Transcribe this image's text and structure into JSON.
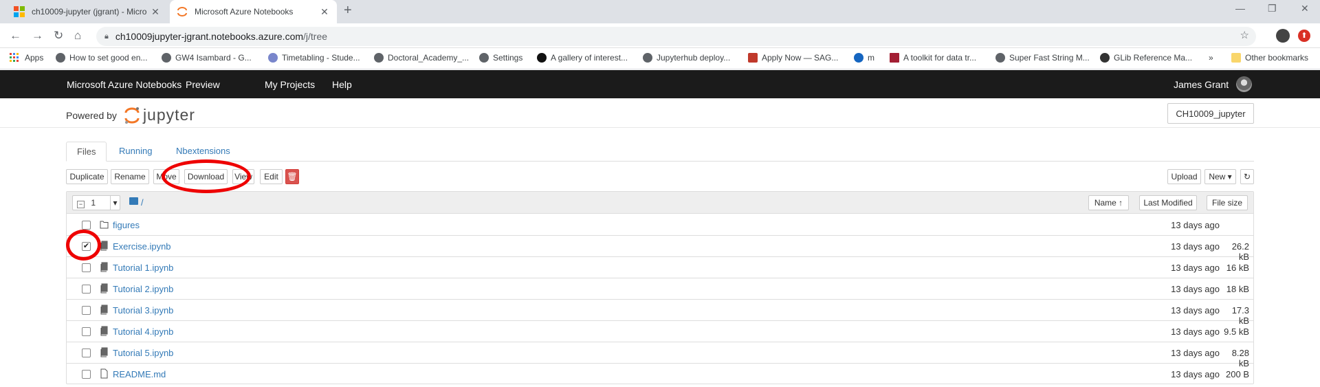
{
  "browser": {
    "tabs": [
      {
        "title": "ch10009-jupyter (jgrant) - Micro"
      },
      {
        "title": "Microsoft Azure Notebooks"
      }
    ],
    "url_host": "ch10009jupyter-jgrant.notebooks.azure.com",
    "url_path": "/j/tree",
    "bookmarks": [
      "Apps",
      "How to set good en...",
      "GW4 Isambard - G...",
      "Timetabling - Stude...",
      "Doctoral_Academy_...",
      "Settings",
      "A gallery of interest...",
      "Jupyterhub deploy...",
      "Apply Now — SAG...",
      "m",
      "A toolkit for data tr...",
      "Super Fast String M...",
      "GLib Reference Ma..."
    ],
    "other_bookmarks": "Other bookmarks",
    "overflow": "»"
  },
  "azure_nav": {
    "brand": "Microsoft Azure Notebooks",
    "preview": "Preview",
    "my_projects": "My Projects",
    "help": "Help",
    "user": "James Grant"
  },
  "header": {
    "powered_by": "Powered by",
    "logo_text": "jupyter",
    "project_button": "CH10009_jupyter"
  },
  "tabs": [
    "Files",
    "Running",
    "Nbextensions"
  ],
  "actions": {
    "duplicate": "Duplicate",
    "rename": "Rename",
    "move": "Move",
    "download": "Download",
    "view": "View",
    "edit": "Edit",
    "upload": "Upload",
    "new": "New ▾"
  },
  "list_header": {
    "selected_count": "1",
    "path": "/",
    "name_col": "Name ↑",
    "modified_col": "Last Modified",
    "size_col": "File size"
  },
  "files": [
    {
      "name": "figures",
      "modified": "13 days ago",
      "size": "",
      "type": "folder",
      "checked": false
    },
    {
      "name": "Exercise.ipynb",
      "modified": "13 days ago",
      "size": "26.2 kB",
      "type": "notebook",
      "checked": true
    },
    {
      "name": "Tutorial 1.ipynb",
      "modified": "13 days ago",
      "size": "16 kB",
      "type": "notebook",
      "checked": false
    },
    {
      "name": "Tutorial 2.ipynb",
      "modified": "13 days ago",
      "size": "18 kB",
      "type": "notebook",
      "checked": false
    },
    {
      "name": "Tutorial 3.ipynb",
      "modified": "13 days ago",
      "size": "17.3 kB",
      "type": "notebook",
      "checked": false
    },
    {
      "name": "Tutorial 4.ipynb",
      "modified": "13 days ago",
      "size": "9.5 kB",
      "type": "notebook",
      "checked": false
    },
    {
      "name": "Tutorial 5.ipynb",
      "modified": "13 days ago",
      "size": "8.28 kB",
      "type": "notebook",
      "checked": false
    },
    {
      "name": "README.md",
      "modified": "13 days ago",
      "size": "200 B",
      "type": "file",
      "checked": false
    }
  ],
  "colors": {
    "link": "#337ab7",
    "annotation": "#e00000",
    "danger": "#d9534f",
    "navbar": "#1b1b1b"
  }
}
